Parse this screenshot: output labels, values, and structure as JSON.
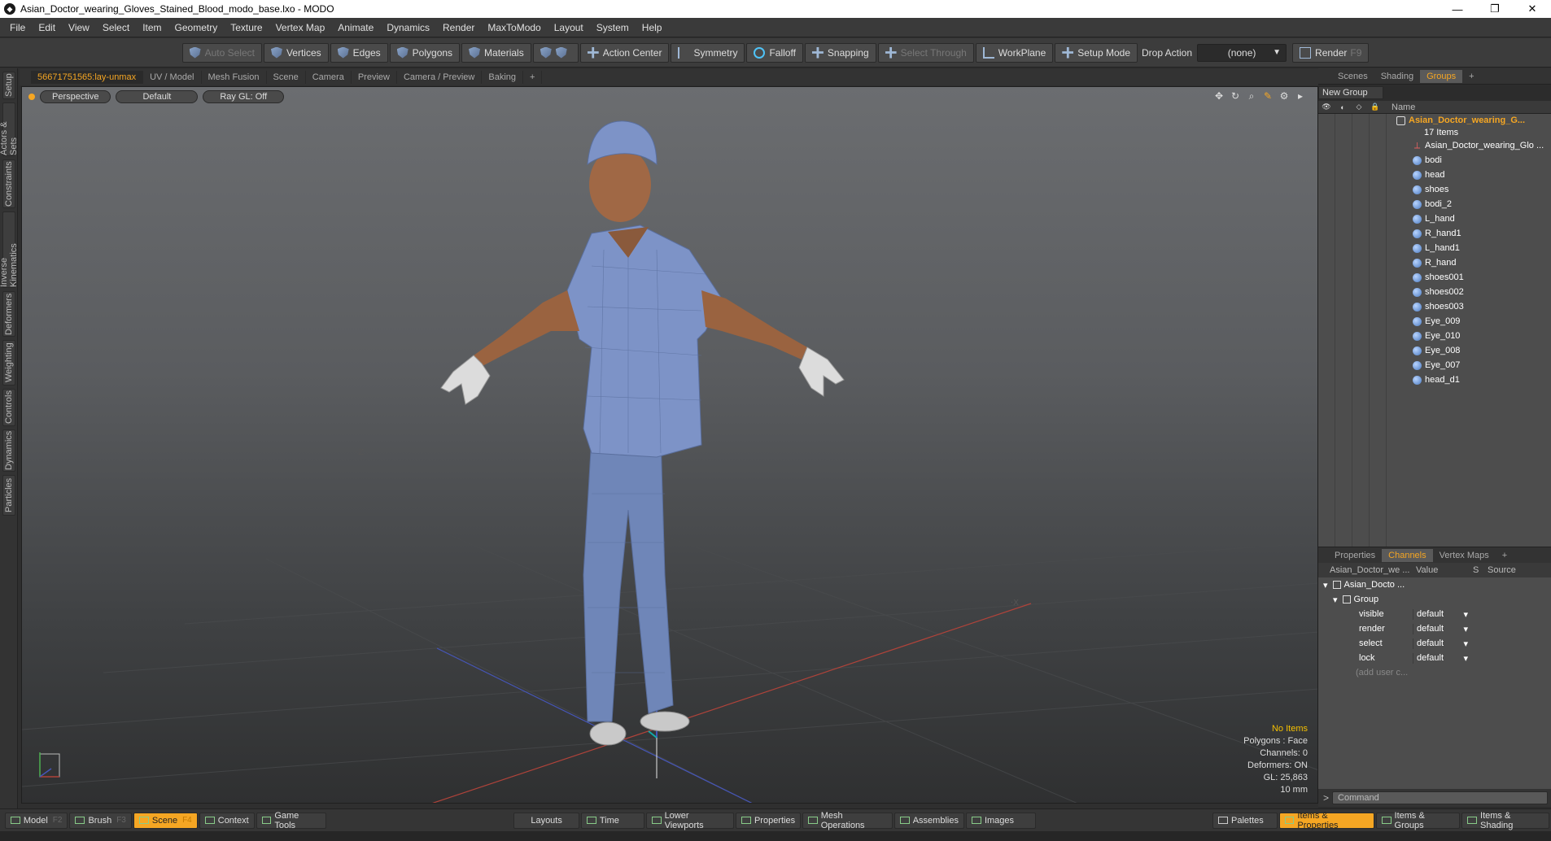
{
  "window": {
    "title": "Asian_Doctor_wearing_Gloves_Stained_Blood_modo_base.lxo - MODO",
    "controls": [
      "—",
      "❐",
      "✕"
    ]
  },
  "menu": [
    "File",
    "Edit",
    "View",
    "Select",
    "Item",
    "Geometry",
    "Texture",
    "Vertex Map",
    "Animate",
    "Dynamics",
    "Render",
    "MaxToModo",
    "Layout",
    "System",
    "Help"
  ],
  "toolbar": {
    "auto_select": "Auto Select",
    "vertices": "Vertices",
    "edges": "Edges",
    "polygons": "Polygons",
    "materials": "Materials",
    "action_center": "Action Center",
    "symmetry": "Symmetry",
    "falloff": "Falloff",
    "snapping": "Snapping",
    "select_through": "Select Through",
    "workplane": "WorkPlane",
    "setup_mode": "Setup Mode",
    "drop_action_label": "Drop Action",
    "drop_action_value": "(none)",
    "render": "Render",
    "render_key": "F9"
  },
  "left_tabs": [
    "Setup",
    "Actors & Sets",
    "Constraints",
    "Inverse Kinematics",
    "Deformers",
    "Weighting",
    "Controls",
    "Dynamics",
    "Particles"
  ],
  "viewport_tabs": [
    "56671751565:lay-unmax",
    "UV / Model",
    "Mesh Fusion",
    "Scene",
    "Camera",
    "Preview",
    "Camera / Preview",
    "Baking",
    "+"
  ],
  "viewport": {
    "view": "Perspective",
    "shading": "Default",
    "raygl": "Ray GL: Off",
    "stats": {
      "items": "No Items",
      "polygons": "Polygons : Face",
      "channels": "Channels: 0",
      "deformers": "Deformers: ON",
      "gl": "GL: 25,863",
      "unit": "10 mm"
    }
  },
  "scene_panel": {
    "tabs": [
      "Scenes",
      "Shading",
      "Groups",
      "+"
    ],
    "new_group": "New Group",
    "name_col": "Name",
    "root": "Asian_Doctor_wearing_G...",
    "root_count": "17 Items",
    "items": [
      "Asian_Doctor_wearing_Glo ...",
      "bodi",
      "head",
      "shoes",
      "bodi_2",
      "L_hand",
      "R_hand1",
      "L_hand1",
      "R_hand",
      "shoes001",
      "shoes002",
      "shoes003",
      "Eye_009",
      "Eye_010",
      "Eye_008",
      "Eye_007",
      "head_d1"
    ]
  },
  "channels_panel": {
    "tabs": [
      "Properties",
      "Channels",
      "Vertex Maps",
      "+"
    ],
    "columns": [
      "Asian_Doctor_we ...",
      "Value",
      "S",
      "Source"
    ],
    "item": "Asian_Docto ...",
    "group": "Group",
    "rows": [
      {
        "name": "visible",
        "value": "default"
      },
      {
        "name": "render",
        "value": "default"
      },
      {
        "name": "select",
        "value": "default"
      },
      {
        "name": "lock",
        "value": "default"
      }
    ],
    "add_user": "(add user c..."
  },
  "command": {
    "placeholder": "Command"
  },
  "bottom": {
    "model": "Model",
    "model_key": "F2",
    "brush": "Brush",
    "brush_key": "F3",
    "scene": "Scene",
    "scene_key": "F4",
    "context": "Context",
    "game_tools": "Game Tools",
    "layouts": "Layouts",
    "time": "Time",
    "lower_viewports": "Lower Viewports",
    "properties": "Properties",
    "mesh_operations": "Mesh Operations",
    "assemblies": "Assemblies",
    "images": "Images",
    "palettes": "Palettes",
    "items_properties": "Items & Properties",
    "items_groups": "Items & Groups",
    "items_shading": "Items & Shading"
  }
}
